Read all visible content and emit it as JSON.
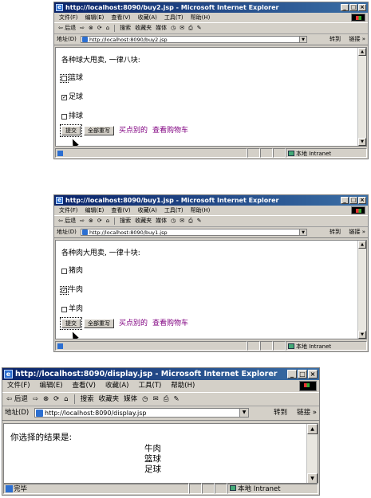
{
  "windows": [
    {
      "title": "http://localhost:8090/buy2.jsp - Microsoft Internet Explorer",
      "menu": [
        "文件(F)",
        "编辑(E)",
        "查看(V)",
        "收藏(A)",
        "工具(T)",
        "帮助(H)"
      ],
      "toolbar": {
        "back": "⇦ 后退",
        "forward": "⇨",
        "stop": "⊗",
        "refresh": "⟳",
        "home": "⌂",
        "search": "搜索",
        "favorites": "收藏夹",
        "media": "媒体",
        "history": "◷",
        "mail": "✉",
        "print": "⎙",
        "edit": "✎"
      },
      "address": {
        "label": "地址(D)",
        "url": "http://localhost:8090/buy2.jsp",
        "go": "转到",
        "links": "链接 »"
      },
      "page": {
        "heading": "各种球大甩卖, 一律八块:",
        "items": [
          {
            "label": "篮球",
            "mark": ""
          },
          {
            "label": "足球",
            "mark": "✓"
          },
          {
            "label": "排球",
            "mark": ""
          }
        ],
        "submit": "提交",
        "reset": "全部重写",
        "links": [
          "买点别的",
          "查看购物车"
        ]
      },
      "status": {
        "text": "",
        "zone": "本地 Intranet"
      }
    },
    {
      "title": "http://localhost:8090/buy1.jsp - Microsoft Internet Explorer",
      "menu": [
        "文件(F)",
        "编辑(E)",
        "查看(V)",
        "收藏(A)",
        "工具(T)",
        "帮助(H)"
      ],
      "toolbar": {
        "back": "⇦ 后退",
        "forward": "⇨",
        "stop": "⊗",
        "refresh": "⟳",
        "home": "⌂",
        "search": "搜索",
        "favorites": "收藏夹",
        "media": "媒体",
        "history": "◷",
        "mail": "✉",
        "print": "⎙",
        "edit": "✎"
      },
      "address": {
        "label": "地址(D)",
        "url": "http://localhost:8090/buy1.jsp",
        "go": "转到",
        "links": "链接 »"
      },
      "page": {
        "heading": "各种肉大甩卖, 一律十块:",
        "items": [
          {
            "label": "猪肉",
            "mark": ""
          },
          {
            "label": "牛肉",
            "mark": "✓"
          },
          {
            "label": "羊肉",
            "mark": ""
          }
        ],
        "submit": "提交",
        "reset": "全部重写",
        "links": [
          "买点别的",
          "查看购物车"
        ]
      },
      "status": {
        "text": "",
        "zone": "本地 Intranet"
      }
    },
    {
      "title": "http://localhost:8090/display.jsp - Microsoft Internet Explorer",
      "menu": [
        "文件(F)",
        "编辑(E)",
        "查看(V)",
        "收藏(A)",
        "工具(T)",
        "帮助(H)"
      ],
      "toolbar": {
        "back": "⇦ 后退",
        "forward": "⇨",
        "stop": "⊗",
        "refresh": "⟳",
        "home": "⌂",
        "search": "搜索",
        "favorites": "收藏夹",
        "media": "媒体",
        "history": "◷",
        "mail": "✉",
        "print": "⎙",
        "edit": "✎"
      },
      "address": {
        "label": "地址(D)",
        "url": "http://localhost:8090/display.jsp",
        "go": "转到",
        "links": "链接 »"
      },
      "page": {
        "heading": "你选择的结果是:",
        "results": [
          "牛肉",
          "篮球",
          "足球"
        ]
      },
      "status": {
        "text": "完毕",
        "zone": "本地 Intranet"
      }
    }
  ]
}
